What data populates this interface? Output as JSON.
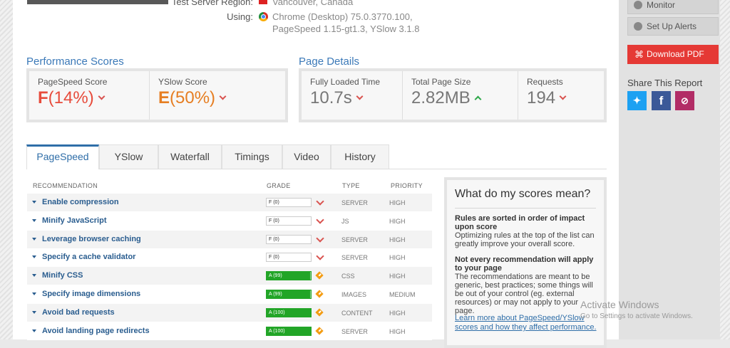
{
  "header": {
    "test_region_label": "Test Server Region:",
    "test_region_value": "Vancouver, Canada",
    "using_label": "Using:",
    "using_browser": "Chrome (Desktop) 75.0.3770.100,",
    "using_versions": "PageSpeed 1.15-gt1.3, YSlow 3.1.8"
  },
  "performance": {
    "title": "Performance Scores",
    "pagespeed": {
      "label": "PageSpeed Score",
      "grade": "F",
      "pct": "(14%)"
    },
    "yslow": {
      "label": "YSlow Score",
      "grade": "E",
      "pct": "(50%)"
    }
  },
  "details": {
    "title": "Page Details",
    "load": {
      "label": "Fully Loaded Time",
      "value": "10.7s"
    },
    "size": {
      "label": "Total Page Size",
      "value": "2.82MB"
    },
    "requests": {
      "label": "Requests",
      "value": "194"
    }
  },
  "tabs": [
    "PageSpeed",
    "YSlow",
    "Waterfall",
    "Timings",
    "Video",
    "History"
  ],
  "table": {
    "headers": {
      "recommendation": "RECOMMENDATION",
      "grade": "GRADE",
      "type": "TYPE",
      "priority": "PRIORITY"
    },
    "rows": [
      {
        "name": "Enable compression",
        "grade": "F (0)",
        "type": "SERVER",
        "priority": "HIGH",
        "score": 0
      },
      {
        "name": "Minify JavaScript",
        "grade": "F (0)",
        "type": "JS",
        "priority": "HIGH",
        "score": 0
      },
      {
        "name": "Leverage browser caching",
        "grade": "F (0)",
        "type": "SERVER",
        "priority": "HIGH",
        "score": 0
      },
      {
        "name": "Specify a cache validator",
        "grade": "F (0)",
        "type": "SERVER",
        "priority": "HIGH",
        "score": 0
      },
      {
        "name": "Minify CSS",
        "grade": "A (99)",
        "type": "CSS",
        "priority": "HIGH",
        "score": 99
      },
      {
        "name": "Specify image dimensions",
        "grade": "A (99)",
        "type": "IMAGES",
        "priority": "MEDIUM",
        "score": 99
      },
      {
        "name": "Avoid bad requests",
        "grade": "A (100)",
        "type": "CONTENT",
        "priority": "HIGH",
        "score": 100
      },
      {
        "name": "Avoid landing page redirects",
        "grade": "A (100)",
        "type": "SERVER",
        "priority": "HIGH",
        "score": 100
      }
    ]
  },
  "explain": {
    "title": "What do my scores mean?",
    "p1_bold": "Rules are sorted in order of impact upon score",
    "p1_text": "Optimizing rules at the top of the list can greatly improve your overall score.",
    "p2_bold": "Not every recommendation will apply to your page",
    "p2_text": "The recommendations are meant to be generic, best practices; some things will be out of your control (eg. external resources) or may not apply to your page.",
    "link": "Learn more about PageSpeed/YSlow scores and how they affect performance."
  },
  "sidebar": {
    "monitor_label": "Monitor",
    "alerts_label": "Set Up Alerts",
    "pdf_label": "Download PDF",
    "share_title": "Share This Report"
  },
  "watermark": {
    "line1": "Activate Windows",
    "line2": "Go to Settings to activate Windows."
  }
}
